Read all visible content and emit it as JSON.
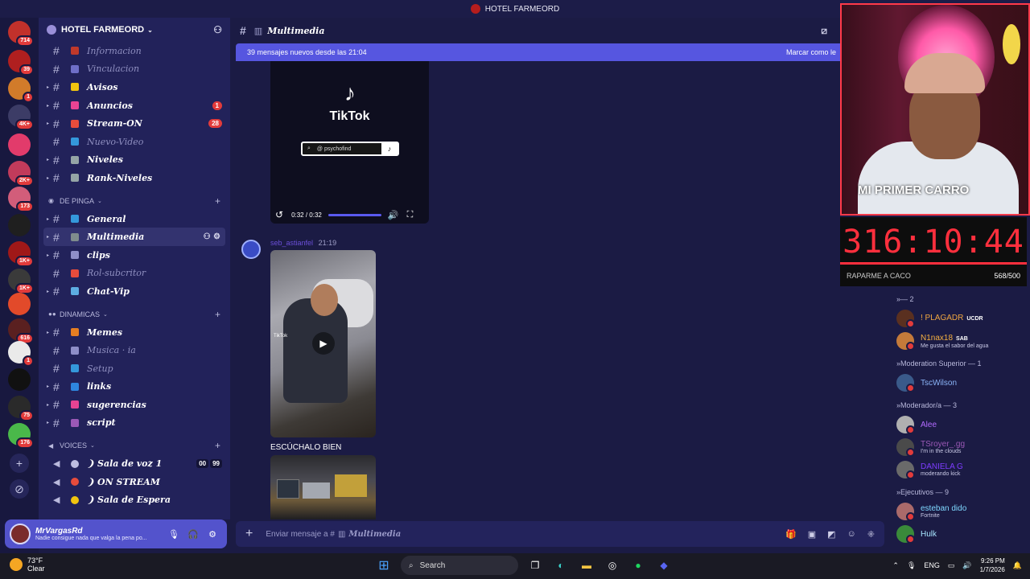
{
  "window": {
    "title": "HOTEL FARMEORD"
  },
  "servers": [
    {
      "badge": "714",
      "color": "#c2312b"
    },
    {
      "badge": "39",
      "color": "#b01f1f"
    },
    {
      "badge": "1",
      "color": "#d17b2a"
    },
    {
      "badge": "4K+",
      "color": "#3c3c66"
    },
    {
      "badge": "",
      "color": "#e23b6b"
    },
    {
      "badge": "2K+",
      "color": "#c23b5b"
    },
    {
      "badge": "173",
      "color": "#d25d7a"
    },
    {
      "badge": "",
      "color": "#1f1f1f"
    },
    {
      "badge": "1K+",
      "color": "#a01818"
    },
    {
      "badge": "1K+",
      "color": "#3a3a3a"
    },
    {
      "badge": "",
      "color": "#e24a2a"
    },
    {
      "badge": "616",
      "color": "#5a2020"
    },
    {
      "badge": "1",
      "color": "#eaeaea"
    },
    {
      "badge": "",
      "color": "#111111"
    },
    {
      "badge": "75",
      "color": "#2a2a2a"
    },
    {
      "badge": "176",
      "color": "#4ab84a"
    }
  ],
  "guild": {
    "name": "HOTEL FARMEORD"
  },
  "channels_top": [
    {
      "name": "Informacion",
      "muted": true,
      "color": "#c0392b"
    },
    {
      "name": "Vinculacion",
      "muted": true,
      "color": "#6f6fc8"
    },
    {
      "name": "Avisos",
      "muted": false,
      "color": "#f1c40f"
    },
    {
      "name": "Anuncios",
      "muted": false,
      "color": "#e84393",
      "count": "1"
    },
    {
      "name": "Stream-ON",
      "muted": false,
      "color": "#e74c3c",
      "count": "28"
    },
    {
      "name": "Nuevo-Video",
      "muted": true,
      "color": "#3498db"
    },
    {
      "name": "Niveles",
      "muted": false,
      "color": "#95a5a6"
    },
    {
      "name": "Rank-Niveles",
      "muted": false,
      "color": "#95a5a6"
    }
  ],
  "cat_de_pinga": {
    "label": "DE PINGA"
  },
  "channels_de_pinga": [
    {
      "name": "General",
      "muted": false,
      "color": "#3498db"
    },
    {
      "name": "Multimedia",
      "muted": false,
      "color": "#7f8c8d",
      "active": true
    },
    {
      "name": "clips",
      "muted": false,
      "color": "#8e8ec8"
    },
    {
      "name": "Rol-subcritor",
      "muted": true,
      "color": "#e74c3c"
    },
    {
      "name": "Chat-Vip",
      "muted": false,
      "color": "#5dade2"
    }
  ],
  "cat_dinamicas": {
    "label": "DINAMICAS"
  },
  "channels_dinamicas": [
    {
      "name": "Memes",
      "muted": false,
      "color": "#e67e22"
    },
    {
      "name": "Musica · ia",
      "muted": true,
      "color": "#8e8ec8"
    },
    {
      "name": "Setup",
      "muted": true,
      "color": "#3498db"
    },
    {
      "name": "links",
      "muted": false,
      "color": "#2e86de"
    },
    {
      "name": "sugerencias",
      "muted": false,
      "color": "#e84393"
    },
    {
      "name": "script",
      "muted": false,
      "color": "#9b59b6"
    }
  ],
  "cat_voices": {
    "label": "VOICES"
  },
  "voice_channels": [
    {
      "name": "❩ Sala de voz 1",
      "counts": [
        "00",
        "99"
      ]
    },
    {
      "name": "❩ ON STREAM",
      "counts": []
    },
    {
      "name": "❩ Sala de Espera",
      "counts": []
    }
  ],
  "user": {
    "name": "MrVargasRd",
    "status": "Nadie consigue nada que valga la pena po..."
  },
  "channel_header": {
    "name": "Multimedia"
  },
  "newbar": {
    "text": "39 mensajes nuevos desde las 21:04",
    "mark": "Marcar como le"
  },
  "video": {
    "brand": "TikTok",
    "handle": "@ psychofind",
    "time": "0:32 / 0:32"
  },
  "message": {
    "author": "seb_astianfel",
    "time": "21:19",
    "image_tag": "TikTok",
    "caption": "ESCÚCHALO BIEN"
  },
  "composer": {
    "placeholder": "Enviar mensaje a #",
    "channel": "Multimedia"
  },
  "webcam": {
    "overlay_text": "MI PRIMER CARRO"
  },
  "timer": {
    "value": "316:10:44",
    "label": "RAPARME A CACO",
    "count": "568/500"
  },
  "members": {
    "group_top": "— 2",
    "top": [
      {
        "name": "! PLAGADR",
        "tag": "UCDR",
        "sub": "",
        "color": "#f0a640"
      },
      {
        "name": "N1nax18",
        "tag": "SAB",
        "sub": "Me gusta el sabor del agua",
        "color": "#f5b041"
      }
    ],
    "group_mod_sup": "Moderation Superior — 1",
    "mod_sup": [
      {
        "name": "TscWilson",
        "tag": "",
        "sub": "",
        "color": "#8ab4f8"
      }
    ],
    "group_mod": "Moderador/a — 3",
    "mod": [
      {
        "name": "Alee",
        "tag": "",
        "sub": "",
        "color": "#b36bff"
      },
      {
        "name": "TSroyer_.gg",
        "tag": "",
        "sub": "I'm in the clouds",
        "color": "#9b59b6"
      },
      {
        "name": "DANIELA G",
        "tag": "",
        "sub": "moderando kick",
        "color": "#7d3cff"
      }
    ],
    "group_exec": "Ejecutivos — 9",
    "exec": [
      {
        "name": "esteban dido",
        "tag": "",
        "sub": "Fortnite",
        "color": "#7fd8ff"
      },
      {
        "name": "Hulk",
        "tag": "",
        "sub": "",
        "color": "#a8e6ff"
      }
    ]
  },
  "taskbar": {
    "temp": "73°F",
    "weather": "Clear",
    "search": "Search",
    "lang": "ENG",
    "time": "9:26 PM",
    "date": "1/7/2026"
  }
}
